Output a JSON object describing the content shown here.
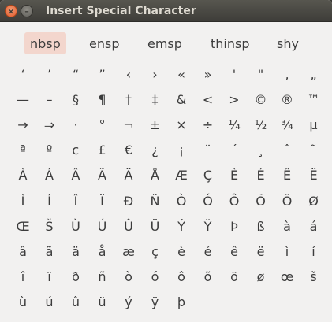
{
  "window": {
    "title": "Insert Special Character"
  },
  "titlebar_buttons": [
    {
      "name": "close-button",
      "glyph": "×"
    },
    {
      "name": "minimize-button",
      "glyph": "–"
    }
  ],
  "space_buttons": [
    {
      "label": "nbsp",
      "selected": true
    },
    {
      "label": "ensp",
      "selected": false
    },
    {
      "label": "emsp",
      "selected": false
    },
    {
      "label": "thinsp",
      "selected": false
    },
    {
      "label": "shy",
      "selected": false
    }
  ],
  "rows": [
    [
      "‘",
      "’",
      "“",
      "”",
      "‹",
      "›",
      "«",
      "»",
      "'",
      "\"",
      ",",
      "„"
    ],
    [
      "—",
      "–",
      "§",
      "¶",
      "†",
      "‡",
      "&",
      "<",
      ">",
      "©",
      "®",
      "™"
    ],
    [
      "→",
      "⇒",
      "·",
      "°",
      "¬",
      "±",
      "×",
      "÷",
      "¼",
      "½",
      "¾",
      "µ"
    ],
    [
      "ª",
      "º",
      "¢",
      "£",
      "€",
      "¿",
      "¡",
      "¨",
      "´",
      "¸",
      "ˆ",
      "˜"
    ],
    [
      "À",
      "Á",
      "Â",
      "Ã",
      "Ä",
      "Å",
      "Æ",
      "Ç",
      "È",
      "É",
      "Ê",
      "Ë"
    ],
    [
      "Ì",
      "Í",
      "Î",
      "Ï",
      "Ð",
      "Ñ",
      "Ò",
      "Ó",
      "Ô",
      "Õ",
      "Ö",
      "Ø"
    ],
    [
      "Œ",
      "Š",
      "Ù",
      "Ú",
      "Û",
      "Ü",
      "Ý",
      "Ÿ",
      "Þ",
      "ß",
      "à",
      "á"
    ],
    [
      "â",
      "ã",
      "ä",
      "å",
      "æ",
      "ç",
      "è",
      "é",
      "ê",
      "ë",
      "ì",
      "í"
    ],
    [
      "î",
      "ï",
      "ð",
      "ñ",
      "ò",
      "ó",
      "ô",
      "õ",
      "ö",
      "ø",
      "œ",
      "š"
    ],
    [
      "ù",
      "ú",
      "û",
      "ü",
      "ý",
      "ÿ",
      "þ"
    ]
  ]
}
